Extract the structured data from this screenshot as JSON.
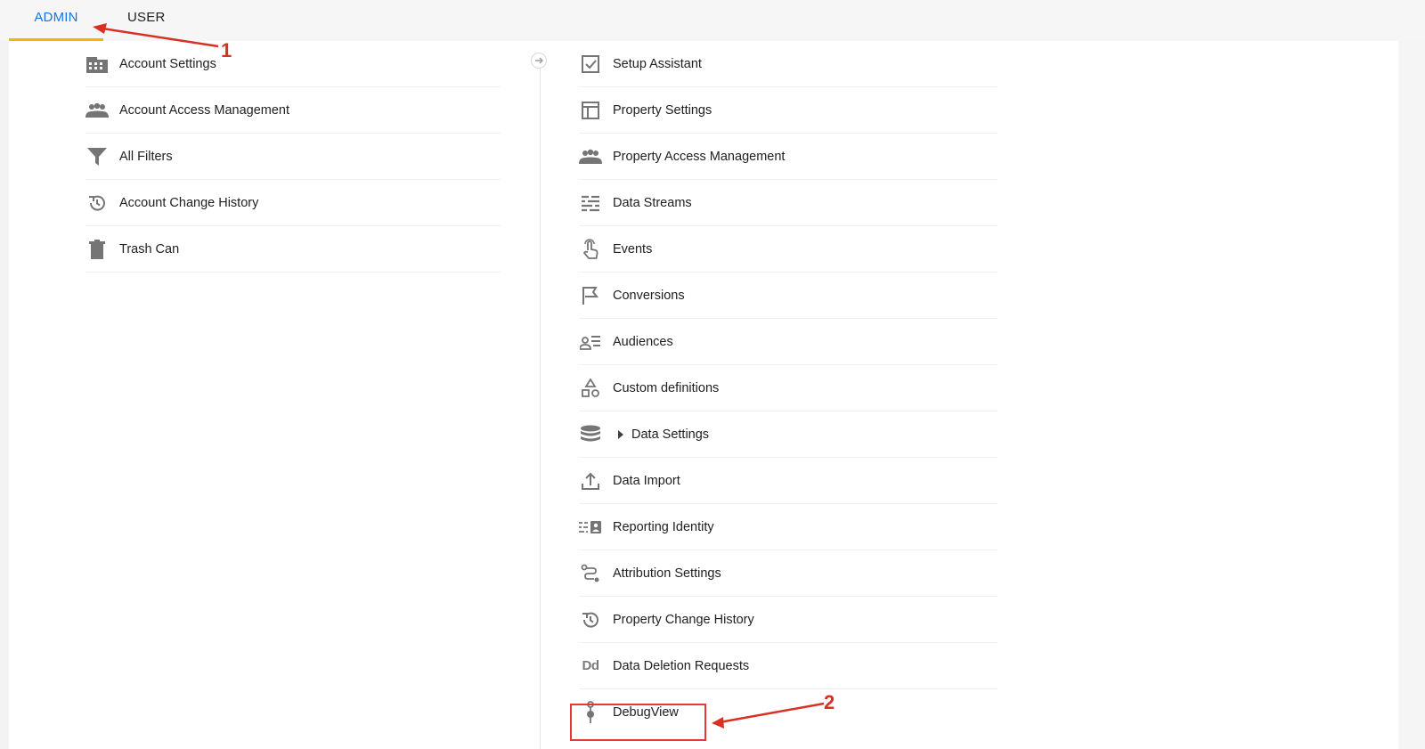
{
  "tabs": [
    {
      "label": "ADMIN",
      "active": true
    },
    {
      "label": "USER",
      "active": false
    }
  ],
  "account_items": [
    {
      "label": "Account Settings",
      "icon": "building-icon"
    },
    {
      "label": "Account Access Management",
      "icon": "people-icon"
    },
    {
      "label": "All Filters",
      "icon": "filter-icon"
    },
    {
      "label": "Account Change History",
      "icon": "history-icon"
    },
    {
      "label": "Trash Can",
      "icon": "trash-icon"
    }
  ],
  "property_items": [
    {
      "label": "Setup Assistant",
      "icon": "checkbox-icon"
    },
    {
      "label": "Property Settings",
      "icon": "layout-icon"
    },
    {
      "label": "Property Access Management",
      "icon": "people-icon"
    },
    {
      "label": "Data Streams",
      "icon": "streams-icon"
    },
    {
      "label": "Events",
      "icon": "touch-icon"
    },
    {
      "label": "Conversions",
      "icon": "flag-icon"
    },
    {
      "label": "Audiences",
      "icon": "audience-icon"
    },
    {
      "label": "Custom definitions",
      "icon": "shapes-icon"
    },
    {
      "label": "Data Settings",
      "icon": "database-icon"
    },
    {
      "label": "Data Import",
      "icon": "upload-icon"
    },
    {
      "label": "Reporting Identity",
      "icon": "identity-icon"
    },
    {
      "label": "Attribution Settings",
      "icon": "attribution-icon"
    },
    {
      "label": "Property Change History",
      "icon": "history-icon"
    },
    {
      "label": "Data Deletion Requests",
      "icon": "dd-icon"
    },
    {
      "label": "DebugView",
      "icon": "debug-icon"
    }
  ],
  "dd_glyph": "Dd",
  "annotations": {
    "first": "1",
    "second": "2"
  },
  "colors": {
    "active_tab": "#1a73e8",
    "tab_underline": "#f4b400",
    "annotation": "#d93025"
  }
}
